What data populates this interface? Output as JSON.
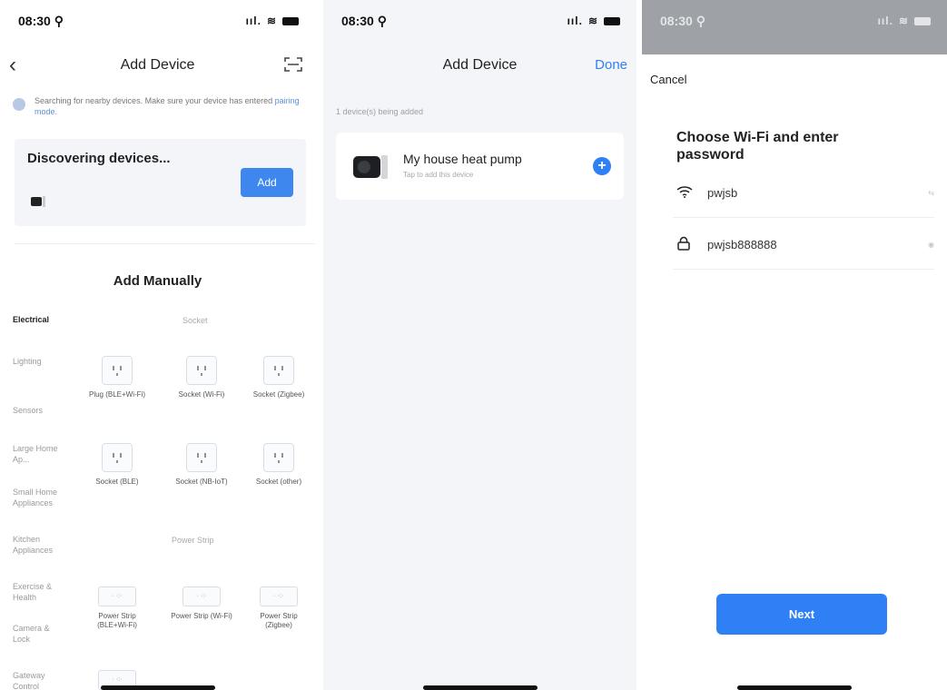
{
  "screen1": {
    "status": {
      "time": "08:30 ⚲",
      "signal": "ııl."
    },
    "nav": {
      "title": "Add Device"
    },
    "notice": {
      "text": "Searching for nearby devices. Make sure your device has entered",
      "link": "pairing mode."
    },
    "discovering": {
      "title": "Discovering devices...",
      "add_label": "Add"
    },
    "manual_title": "Add Manually",
    "categories": [
      "Electrical",
      "Lighting",
      "Sensors",
      "Large Home Ap...",
      "Small Home Appliances",
      "Kitchen Appliances",
      "Exercise & Health",
      "Camera & Lock",
      "Gateway Control"
    ],
    "sections": {
      "socket": "Socket",
      "power_strip": "Power Strip"
    },
    "socket_tiles": [
      "Plug (BLE+Wi-Fi)",
      "Socket (Wi-Fi)",
      "Socket (Zigbee)",
      "Socket (BLE)",
      "Socket (NB-IoT)",
      "Socket (other)"
    ],
    "strip_tiles": [
      "Power Strip (BLE+Wi-Fi)",
      "Power Strip (Wi-Fi)",
      "Power Strip (Zigbee)"
    ]
  },
  "screen2": {
    "status": {
      "time": "08:30 ⚲",
      "signal": "ııl."
    },
    "nav": {
      "title": "Add Device",
      "done": "Done"
    },
    "being_added": "1 device(s) being added",
    "device": {
      "name": "My house heat pump",
      "sub": "Tap to add this device"
    }
  },
  "screen3": {
    "status": {
      "time": "08:30 ⚲",
      "signal": "ııl."
    },
    "cancel": "Cancel",
    "title": "Choose Wi-Fi and enter password",
    "wifi": {
      "ssid": "pwjsb",
      "tail": "⇆"
    },
    "password": {
      "value": "pwjsb888888",
      "tail": "◉"
    },
    "next": "Next"
  }
}
